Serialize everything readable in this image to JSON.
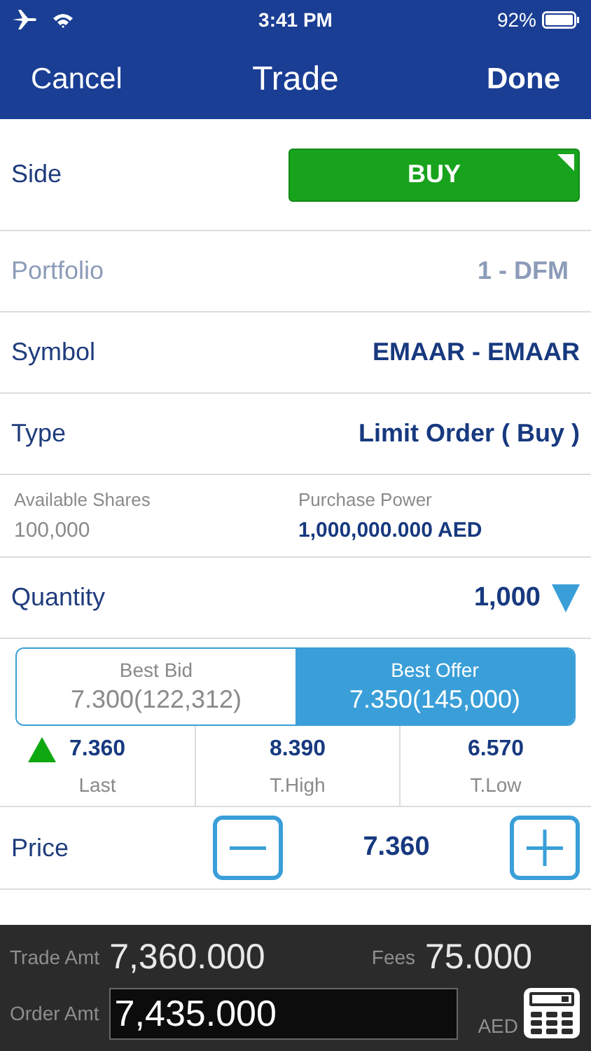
{
  "status_bar": {
    "time": "3:41 PM",
    "battery": "92%"
  },
  "nav": {
    "cancel": "Cancel",
    "title": "Trade",
    "done": "Done"
  },
  "side": {
    "label": "Side",
    "value": "BUY"
  },
  "fields": [
    {
      "label": "Portfolio",
      "value": "1 - DFM",
      "disabled": true
    },
    {
      "label": "Symbol",
      "value": "EMAAR - EMAAR",
      "disabled": false
    },
    {
      "label": "Type",
      "value": "Limit Order ( Buy )",
      "disabled": false
    }
  ],
  "balances": [
    {
      "label": "Available Shares",
      "value": "100,000",
      "kind": "plain"
    },
    {
      "label": "Purchase Power",
      "value": "1,000,000.000 AED",
      "kind": "strong"
    }
  ],
  "quantity": {
    "label": "Quantity",
    "value": "1,000"
  },
  "quote_tabs": [
    {
      "label": "Best Bid",
      "value": "7.300(122,312)",
      "selected": false
    },
    {
      "label": "Best Offer",
      "value": "7.350(145,000)",
      "selected": true
    }
  ],
  "stats": [
    {
      "value": "7.360",
      "label": "Last",
      "rising": true
    },
    {
      "value": "8.390",
      "label": "T.High",
      "rising": false
    },
    {
      "value": "6.570",
      "label": "T.Low",
      "rising": false
    }
  ],
  "price": {
    "label": "Price",
    "value": "7.360"
  },
  "summary": {
    "trade_label": "Trade Amt",
    "trade_value": "7,360.000",
    "fees_label": "Fees",
    "fees_value": "75.000",
    "order_label": "Order Amt",
    "order_value": "7,435.000",
    "currency": "AED"
  }
}
